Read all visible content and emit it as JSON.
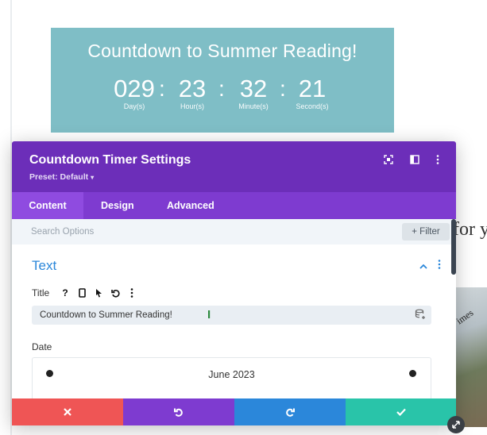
{
  "countdown": {
    "title": "Countdown to Summer Reading!",
    "units": [
      {
        "value": "029",
        "label": "Day(s)"
      },
      {
        "value": "23",
        "label": "Hour(s)"
      },
      {
        "value": "32",
        "label": "Minute(s)"
      },
      {
        "value": "21",
        "label": "Second(s)"
      }
    ],
    "separator": ":"
  },
  "background": {
    "partial_text": "for y",
    "image_text": "imes"
  },
  "modal": {
    "title": "Countdown Timer Settings",
    "preset": "Preset: Default",
    "preset_caret": "▾",
    "tabs": [
      {
        "label": "Content",
        "active": true
      },
      {
        "label": "Design",
        "active": false
      },
      {
        "label": "Advanced",
        "active": false
      }
    ],
    "search_placeholder": "Search Options",
    "filter_label": "+ Filter",
    "section": {
      "title": "Text",
      "toggle": "^"
    },
    "title_field": {
      "label": "Title",
      "help_icon": "?",
      "value": "Countdown to Summer Reading!"
    },
    "date_field": {
      "label": "Date",
      "month": "June 2023"
    }
  },
  "colors": {
    "module_bg": "#7fbec6",
    "header": "#6c2eb9",
    "tabs": "#7e3bd0",
    "section_accent": "#2b87da",
    "cancel": "#ef5555",
    "undo": "#7e3bd0",
    "redo": "#2b87da",
    "save": "#29c4a9"
  },
  "icons": {
    "header": [
      "expand-icon",
      "split-view-icon",
      "more-vertical-icon"
    ],
    "field_toolbar": [
      "help-icon",
      "mobile-icon",
      "pointer-icon",
      "reset-icon",
      "more-vertical-icon"
    ],
    "footer": [
      "close-icon",
      "undo-icon",
      "redo-icon",
      "check-icon"
    ]
  }
}
